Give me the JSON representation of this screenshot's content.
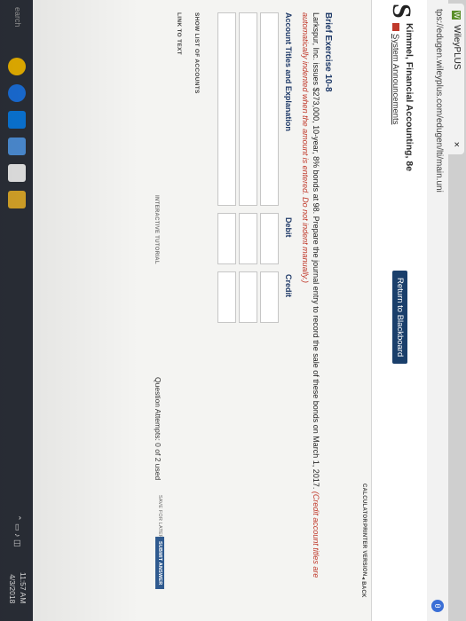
{
  "browser": {
    "tab_title": "WileyPLUS",
    "tab_close": "×",
    "url": "tps://edugen.wileyplus.com/edugen/lti/main.uni",
    "profile_icon": "θ"
  },
  "header": {
    "logo": "S",
    "course": "Kimmel, Financial Accounting, 8e",
    "announcements": "System Announcements",
    "return_button": "Return to Blackboard"
  },
  "toolbar": {
    "calculator": "CALCULATOR",
    "printer": "PRINTER VERSION",
    "back": "◂ BACK"
  },
  "question": {
    "title": "Brief Exercise 10-8",
    "text": "Larkspur, Inc. issues $273,000, 10-year, 8% bonds at 98. Prepare the journal entry to record the sale of these bonds on March 1, 2017.",
    "instruction": "(Credit account titles are automatically indented when the amount is entered. Do not indent manually.)"
  },
  "table": {
    "col_account": "Account Titles and Explanation",
    "col_debit": "Debit",
    "col_credit": "Credit",
    "rows": 3
  },
  "links": {
    "show_accounts": "SHOW LIST OF ACCOUNTS",
    "link_text": "LINK TO TEXT",
    "tutorial": "INTERACTIVE TUTORIAL"
  },
  "footer": {
    "attempts": "Question Attempts: 0 of 2 used",
    "save_later": "SAVE FOR LATER",
    "submit": "SUBMIT ANSWER"
  },
  "taskbar": {
    "search": "earch",
    "time": "11:57 AM",
    "date": "4/3/2018"
  }
}
